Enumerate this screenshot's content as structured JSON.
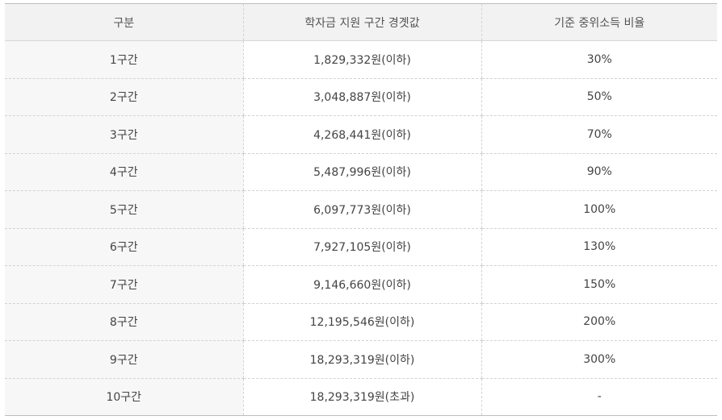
{
  "table": {
    "headers": [
      "구분",
      "학자금 지원 구간 경곗값",
      "기준 중위소득 비율"
    ],
    "rows": [
      {
        "section": "1구간",
        "threshold": "1,829,332원(이하)",
        "ratio": "30%"
      },
      {
        "section": "2구간",
        "threshold": "3,048,887원(이하)",
        "ratio": "50%"
      },
      {
        "section": "3구간",
        "threshold": "4,268,441원(이하)",
        "ratio": "70%"
      },
      {
        "section": "4구간",
        "threshold": "5,487,996원(이하)",
        "ratio": "90%"
      },
      {
        "section": "5구간",
        "threshold": "6,097,773원(이하)",
        "ratio": "100%"
      },
      {
        "section": "6구간",
        "threshold": "7,927,105원(이하)",
        "ratio": "130%"
      },
      {
        "section": "7구간",
        "threshold": "9,146,660원(이하)",
        "ratio": "150%"
      },
      {
        "section": "8구간",
        "threshold": "12,195,546원(이하)",
        "ratio": "200%"
      },
      {
        "section": "9구간",
        "threshold": "18,293,319원(이하)",
        "ratio": "300%"
      },
      {
        "section": "10구간",
        "threshold": "18,293,319원(초과)",
        "ratio": "-"
      }
    ]
  }
}
